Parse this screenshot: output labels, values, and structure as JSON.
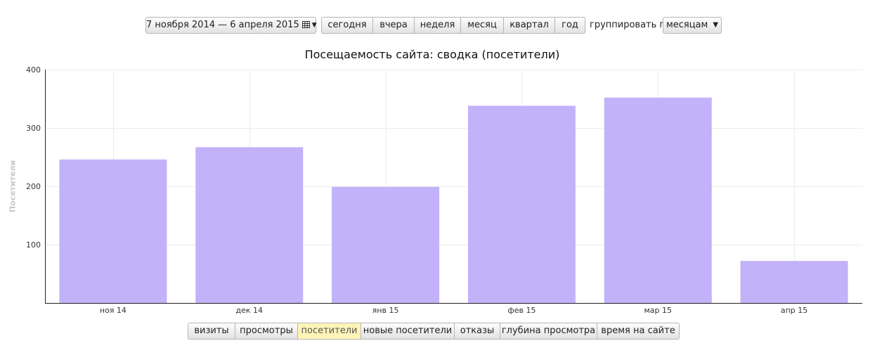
{
  "controls": {
    "date_range": "7 ноября 2014 — 6 апреля 2015",
    "periods": [
      "сегодня",
      "вчера",
      "неделя",
      "месяц",
      "квартал",
      "год"
    ],
    "group_label": "группировать по",
    "group_select": "месяцам"
  },
  "metrics": {
    "tabs": [
      "визиты",
      "просмотры",
      "посетители",
      "новые посетители",
      "отказы",
      "глубина просмотра",
      "время на сайте"
    ],
    "active": "посетители"
  },
  "chart_data": {
    "type": "bar",
    "title": "Посещаемость сайта: сводка (посетители)",
    "ylabel": "Посетители",
    "xlabel": "",
    "categories": [
      "ноя 14",
      "дек 14",
      "янв 15",
      "фев 15",
      "мар 15",
      "апр 15"
    ],
    "values": [
      246,
      267,
      199,
      338,
      352,
      72
    ],
    "ylim": [
      0,
      400
    ],
    "yticks": [
      100,
      200,
      300,
      400
    ],
    "grid": true,
    "bar_color": "#c2b2f9"
  }
}
